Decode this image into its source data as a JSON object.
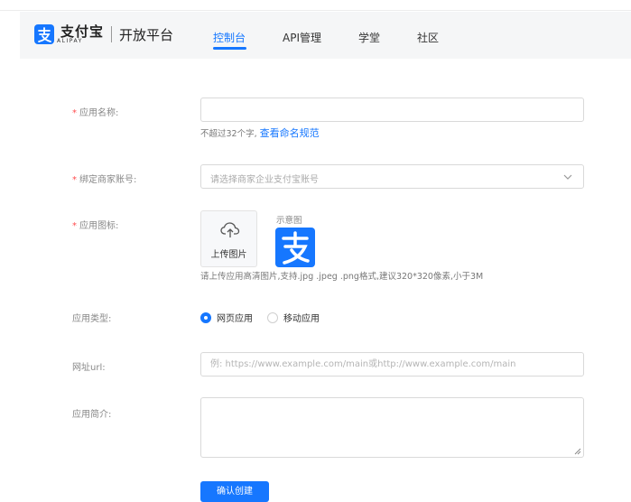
{
  "header": {
    "brand_cn": "支付宝",
    "brand_en": "ALIPAY",
    "platform": "开放平台",
    "nav": [
      {
        "label": "控制台",
        "active": true
      },
      {
        "label": "API管理",
        "active": false
      },
      {
        "label": "学堂",
        "active": false
      },
      {
        "label": "社区",
        "active": false
      }
    ]
  },
  "form": {
    "app_name": {
      "required_mark": "*",
      "label": "应用名称:",
      "value": "",
      "hint": "不超过32个字,",
      "hint_link": "查看命名规范"
    },
    "merchant": {
      "required_mark": "*",
      "label": "绑定商家账号:",
      "placeholder": "请选择商家企业支付宝账号"
    },
    "icon": {
      "required_mark": "*",
      "label": "应用图标:",
      "upload_text": "上传图片",
      "sample_label": "示意图",
      "hint": "请上传应用高清图片,支持.jpg .jpeg .png格式,建议320*320像素,小于3M"
    },
    "app_type": {
      "label": "应用类型:",
      "options": [
        {
          "label": "网页应用",
          "checked": true
        },
        {
          "label": "移动应用",
          "checked": false
        }
      ]
    },
    "url": {
      "label": "网址url:",
      "placeholder": "例: https://www.example.com/main或http://www.example.com/main"
    },
    "intro": {
      "label": "应用简介:",
      "value": ""
    },
    "submit_label": "确认创建"
  },
  "colors": {
    "accent": "#1677ff",
    "required": "#ff4d4f",
    "header_bg": "#f5f6f7"
  }
}
